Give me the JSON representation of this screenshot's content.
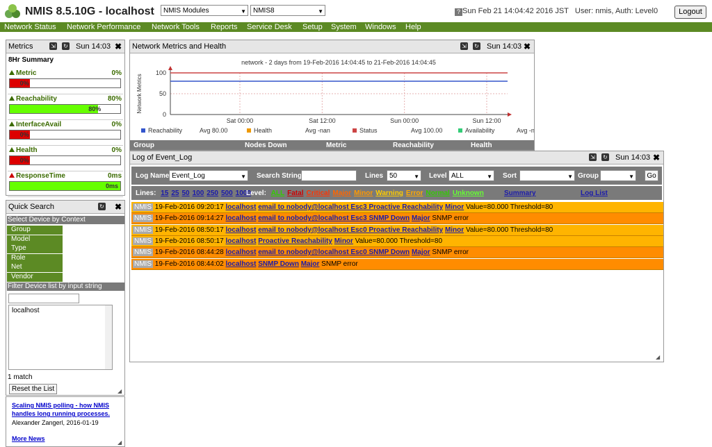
{
  "header": {
    "app_title": "NMIS 8.5.10G - localhost",
    "modules_select": "NMIS Modules",
    "server_select": "NMIS8",
    "clock": "Sun Feb 21 14:04:42 2016 JST",
    "user_info": "User: nmis, Auth: Level0",
    "logout_label": "Logout"
  },
  "menu": [
    "Network Status",
    "Network Performance",
    "Network Tools",
    "Reports",
    "Service Desk",
    "Setup",
    "System",
    "Windows",
    "Help"
  ],
  "metrics_panel": {
    "title": "Metrics",
    "time": "Sun 14:03",
    "summary_label": "8Hr Summary",
    "rows": [
      {
        "label": "Metric",
        "pct": "0%",
        "bar_text": "0%",
        "fill": 0.18,
        "color": "#dd0000",
        "trend": "up"
      },
      {
        "label": "Reachability",
        "pct": "80%",
        "bar_text": "80%",
        "fill": 0.8,
        "color": "#66ff00",
        "trend": "up"
      },
      {
        "label": "InterfaceAvail",
        "pct": "0%",
        "bar_text": "0%",
        "fill": 0.18,
        "color": "#dd0000",
        "trend": "up"
      },
      {
        "label": "Health",
        "pct": "0%",
        "bar_text": "0%",
        "fill": 0.18,
        "color": "#dd0000",
        "trend": "up"
      },
      {
        "label": "ResponseTime",
        "pct": "0ms",
        "bar_text": "0ms",
        "fill": 1.0,
        "color": "#66ff00",
        "trend": "up-red"
      }
    ]
  },
  "quick_search": {
    "title": "Quick Search",
    "context_header": "Select Device by Context",
    "contexts": [
      "Group",
      "Model",
      "Type",
      "Role",
      "Net",
      "Vendor"
    ],
    "filter_header": "Filter Device list by input string",
    "filter_value": "",
    "devices": [
      "localhost"
    ],
    "match_count": "1 match",
    "reset_label": "Reset the List"
  },
  "news": {
    "headline": "Scaling NMIS polling - how NMIS handles long running processes.",
    "byline": "Alexander Zangerl, 2016-01-19",
    "more_label": "More News"
  },
  "health_panel": {
    "title": "Network Metrics and Health",
    "time": "Sun 14:03",
    "table_headers": [
      "Group",
      "Nodes Down",
      "Metric",
      "Reachability",
      "Health"
    ]
  },
  "chart_data": {
    "type": "line",
    "title": "network - 2 days from 19-Feb-2016 14:04:45 to 21-Feb-2016 14:04:45",
    "ylabel": "Network Metrics",
    "xlabel": "",
    "ylim": [
      0,
      100
    ],
    "yticks": [
      0,
      50,
      100
    ],
    "xticks": [
      "Sat 00:00",
      "Sat 12:00",
      "Sun 00:00",
      "Sun 12:00"
    ],
    "x": [
      0,
      1
    ],
    "series": [
      {
        "name": "Reachability",
        "color": "#3355cc",
        "values": [
          80,
          80
        ]
      },
      {
        "name": "Status",
        "color": "#cc4444",
        "values": [
          100,
          100
        ]
      }
    ],
    "legend": [
      {
        "name": "Reachability",
        "color": "#3355cc",
        "value": "Avg 80.00"
      },
      {
        "name": "Health",
        "color": "#ee9900",
        "value": "Avg -nan"
      },
      {
        "name": "Status",
        "color": "#cc4444",
        "value": "Avg 100.00"
      },
      {
        "name": "Availability",
        "color": "#33cc77",
        "value": "Avg -nan"
      }
    ]
  },
  "event_log": {
    "title": "Log of Event_Log",
    "time": "Sun 14:03",
    "filters": {
      "log_name_label": "Log Name",
      "log_name_value": "Event_Log",
      "search_label": "Search String",
      "lines_label": "Lines",
      "lines_value": "50",
      "level_label": "Level",
      "level_value": "ALL",
      "sort_label": "Sort",
      "group_label": "Group",
      "go_label": "Go"
    },
    "lines_links_label": "Lines:",
    "lines_links": [
      "15",
      "25",
      "50",
      "100",
      "250",
      "500",
      "1000"
    ],
    "level_links_label": "Level:",
    "level_links": [
      {
        "text": "ALL",
        "color": "#33cc00"
      },
      {
        "text": "Fatal",
        "color": "#cc0000"
      },
      {
        "text": "Critical",
        "color": "#ff3300"
      },
      {
        "text": "Major",
        "color": "#ff6600"
      },
      {
        "text": "Minor",
        "color": "#ff9900"
      },
      {
        "text": "Warning",
        "color": "#ffcc00"
      },
      {
        "text": "Error",
        "color": "#ffaa00"
      },
      {
        "text": "Normal",
        "color": "#33cc00"
      },
      {
        "text": "Unknown",
        "color": "#66ff33"
      }
    ],
    "summary_link": "Summary",
    "loglist_link": "Log List",
    "entries": [
      {
        "tag": "NMIS",
        "time": "19-Feb-2016 09:20:17",
        "node": "localhost",
        "event": "email to nobody@localhost Esc3 Proactive Reachability",
        "level": "Minor",
        "detail": "Value=80.000 Threshold=80",
        "severity": "minor"
      },
      {
        "tag": "NMIS",
        "time": "19-Feb-2016 09:14:27",
        "node": "localhost",
        "event": "email to nobody@localhost Esc3 SNMP Down",
        "level": "Major",
        "detail": "SNMP error",
        "severity": "major"
      },
      {
        "tag": "NMIS",
        "time": "19-Feb-2016 08:50:17",
        "node": "localhost",
        "event": "email to nobody@localhost Esc0 Proactive Reachability",
        "level": "Minor",
        "detail": "Value=80.000 Threshold=80",
        "severity": "minor"
      },
      {
        "tag": "NMIS",
        "time": "19-Feb-2016 08:50:17",
        "node": "localhost",
        "event": "Proactive Reachability",
        "level": "Minor",
        "detail": "Value=80.000 Threshold=80",
        "severity": "minor"
      },
      {
        "tag": "NMIS",
        "time": "19-Feb-2016 08:44:28",
        "node": "localhost",
        "event": "email to nobody@localhost Esc0 SNMP Down",
        "level": "Major",
        "detail": "SNMP error",
        "severity": "major"
      },
      {
        "tag": "NMIS",
        "time": "19-Feb-2016 08:44:02",
        "node": "localhost",
        "event": "SNMP Down",
        "level": "Major",
        "detail": "SNMP error",
        "severity": "major"
      }
    ]
  }
}
